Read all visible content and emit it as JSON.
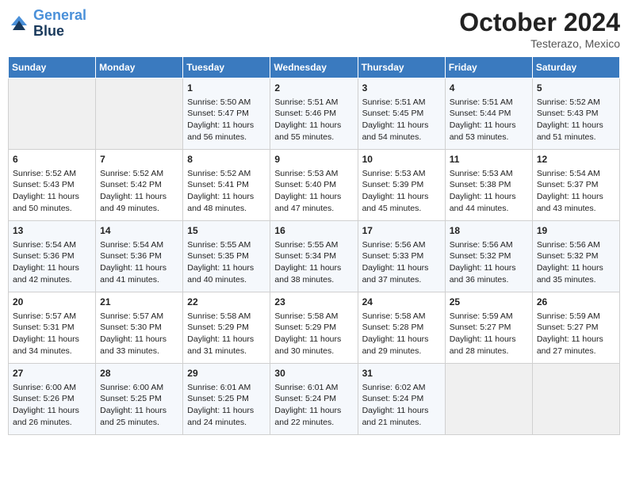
{
  "header": {
    "logo_line1": "General",
    "logo_line2": "Blue",
    "month_year": "October 2024",
    "location": "Testerazo, Mexico"
  },
  "weekdays": [
    "Sunday",
    "Monday",
    "Tuesday",
    "Wednesday",
    "Thursday",
    "Friday",
    "Saturday"
  ],
  "weeks": [
    [
      {
        "day": "",
        "empty": true
      },
      {
        "day": "",
        "empty": true
      },
      {
        "day": "1",
        "sunrise": "Sunrise: 5:50 AM",
        "sunset": "Sunset: 5:47 PM",
        "daylight": "Daylight: 11 hours and 56 minutes."
      },
      {
        "day": "2",
        "sunrise": "Sunrise: 5:51 AM",
        "sunset": "Sunset: 5:46 PM",
        "daylight": "Daylight: 11 hours and 55 minutes."
      },
      {
        "day": "3",
        "sunrise": "Sunrise: 5:51 AM",
        "sunset": "Sunset: 5:45 PM",
        "daylight": "Daylight: 11 hours and 54 minutes."
      },
      {
        "day": "4",
        "sunrise": "Sunrise: 5:51 AM",
        "sunset": "Sunset: 5:44 PM",
        "daylight": "Daylight: 11 hours and 53 minutes."
      },
      {
        "day": "5",
        "sunrise": "Sunrise: 5:52 AM",
        "sunset": "Sunset: 5:43 PM",
        "daylight": "Daylight: 11 hours and 51 minutes."
      }
    ],
    [
      {
        "day": "6",
        "sunrise": "Sunrise: 5:52 AM",
        "sunset": "Sunset: 5:43 PM",
        "daylight": "Daylight: 11 hours and 50 minutes."
      },
      {
        "day": "7",
        "sunrise": "Sunrise: 5:52 AM",
        "sunset": "Sunset: 5:42 PM",
        "daylight": "Daylight: 11 hours and 49 minutes."
      },
      {
        "day": "8",
        "sunrise": "Sunrise: 5:52 AM",
        "sunset": "Sunset: 5:41 PM",
        "daylight": "Daylight: 11 hours and 48 minutes."
      },
      {
        "day": "9",
        "sunrise": "Sunrise: 5:53 AM",
        "sunset": "Sunset: 5:40 PM",
        "daylight": "Daylight: 11 hours and 47 minutes."
      },
      {
        "day": "10",
        "sunrise": "Sunrise: 5:53 AM",
        "sunset": "Sunset: 5:39 PM",
        "daylight": "Daylight: 11 hours and 45 minutes."
      },
      {
        "day": "11",
        "sunrise": "Sunrise: 5:53 AM",
        "sunset": "Sunset: 5:38 PM",
        "daylight": "Daylight: 11 hours and 44 minutes."
      },
      {
        "day": "12",
        "sunrise": "Sunrise: 5:54 AM",
        "sunset": "Sunset: 5:37 PM",
        "daylight": "Daylight: 11 hours and 43 minutes."
      }
    ],
    [
      {
        "day": "13",
        "sunrise": "Sunrise: 5:54 AM",
        "sunset": "Sunset: 5:36 PM",
        "daylight": "Daylight: 11 hours and 42 minutes."
      },
      {
        "day": "14",
        "sunrise": "Sunrise: 5:54 AM",
        "sunset": "Sunset: 5:36 PM",
        "daylight": "Daylight: 11 hours and 41 minutes."
      },
      {
        "day": "15",
        "sunrise": "Sunrise: 5:55 AM",
        "sunset": "Sunset: 5:35 PM",
        "daylight": "Daylight: 11 hours and 40 minutes."
      },
      {
        "day": "16",
        "sunrise": "Sunrise: 5:55 AM",
        "sunset": "Sunset: 5:34 PM",
        "daylight": "Daylight: 11 hours and 38 minutes."
      },
      {
        "day": "17",
        "sunrise": "Sunrise: 5:56 AM",
        "sunset": "Sunset: 5:33 PM",
        "daylight": "Daylight: 11 hours and 37 minutes."
      },
      {
        "day": "18",
        "sunrise": "Sunrise: 5:56 AM",
        "sunset": "Sunset: 5:32 PM",
        "daylight": "Daylight: 11 hours and 36 minutes."
      },
      {
        "day": "19",
        "sunrise": "Sunrise: 5:56 AM",
        "sunset": "Sunset: 5:32 PM",
        "daylight": "Daylight: 11 hours and 35 minutes."
      }
    ],
    [
      {
        "day": "20",
        "sunrise": "Sunrise: 5:57 AM",
        "sunset": "Sunset: 5:31 PM",
        "daylight": "Daylight: 11 hours and 34 minutes."
      },
      {
        "day": "21",
        "sunrise": "Sunrise: 5:57 AM",
        "sunset": "Sunset: 5:30 PM",
        "daylight": "Daylight: 11 hours and 33 minutes."
      },
      {
        "day": "22",
        "sunrise": "Sunrise: 5:58 AM",
        "sunset": "Sunset: 5:29 PM",
        "daylight": "Daylight: 11 hours and 31 minutes."
      },
      {
        "day": "23",
        "sunrise": "Sunrise: 5:58 AM",
        "sunset": "Sunset: 5:29 PM",
        "daylight": "Daylight: 11 hours and 30 minutes."
      },
      {
        "day": "24",
        "sunrise": "Sunrise: 5:58 AM",
        "sunset": "Sunset: 5:28 PM",
        "daylight": "Daylight: 11 hours and 29 minutes."
      },
      {
        "day": "25",
        "sunrise": "Sunrise: 5:59 AM",
        "sunset": "Sunset: 5:27 PM",
        "daylight": "Daylight: 11 hours and 28 minutes."
      },
      {
        "day": "26",
        "sunrise": "Sunrise: 5:59 AM",
        "sunset": "Sunset: 5:27 PM",
        "daylight": "Daylight: 11 hours and 27 minutes."
      }
    ],
    [
      {
        "day": "27",
        "sunrise": "Sunrise: 6:00 AM",
        "sunset": "Sunset: 5:26 PM",
        "daylight": "Daylight: 11 hours and 26 minutes."
      },
      {
        "day": "28",
        "sunrise": "Sunrise: 6:00 AM",
        "sunset": "Sunset: 5:25 PM",
        "daylight": "Daylight: 11 hours and 25 minutes."
      },
      {
        "day": "29",
        "sunrise": "Sunrise: 6:01 AM",
        "sunset": "Sunset: 5:25 PM",
        "daylight": "Daylight: 11 hours and 24 minutes."
      },
      {
        "day": "30",
        "sunrise": "Sunrise: 6:01 AM",
        "sunset": "Sunset: 5:24 PM",
        "daylight": "Daylight: 11 hours and 22 minutes."
      },
      {
        "day": "31",
        "sunrise": "Sunrise: 6:02 AM",
        "sunset": "Sunset: 5:24 PM",
        "daylight": "Daylight: 11 hours and 21 minutes."
      },
      {
        "day": "",
        "empty": true
      },
      {
        "day": "",
        "empty": true
      }
    ]
  ]
}
